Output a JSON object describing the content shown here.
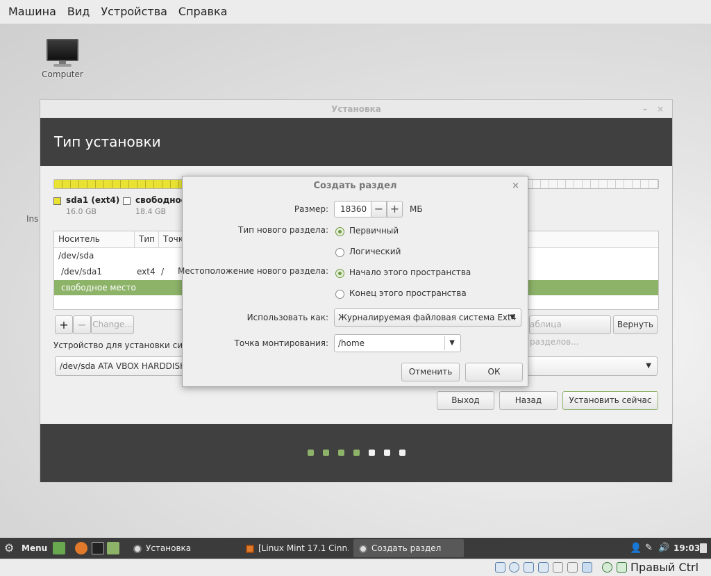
{
  "vbox_menu": [
    "Машина",
    "Вид",
    "Устройства",
    "Справка"
  ],
  "desktop": {
    "icon_label": "Computer",
    "partial_text": "Ins"
  },
  "installer": {
    "title": "Установка",
    "minimize": "–",
    "close": "×",
    "header": "Тип установки",
    "legend": [
      {
        "name": "sda1 (ext4)",
        "size": "16.0 GB",
        "color": "#e9e233"
      },
      {
        "name": "свободное",
        "size": "18.4 GB",
        "color": "#ffffff"
      }
    ],
    "table": {
      "headers": [
        "Носитель",
        "Тип",
        "Точк"
      ],
      "rows": [
        {
          "device": "/dev/sda",
          "type": "",
          "mount": ""
        },
        {
          "device": "/dev/sda1",
          "type": "ext4",
          "mount": "/"
        },
        {
          "device": "свободное место",
          "type": "",
          "mount": ""
        }
      ]
    },
    "buttons": {
      "add": "+",
      "remove": "−",
      "change": "Change...",
      "new_table": "аблица разделов...",
      "revert": "Вернуть",
      "quit": "Выход",
      "back": "Назад",
      "install": "Установить сейчас"
    },
    "device_label": "Устройство для установки сист",
    "device_value": "/dev/sda   ATA VBOX HARDDISK",
    "progress_dots": [
      true,
      true,
      true,
      true,
      false,
      false,
      false
    ]
  },
  "dialog": {
    "title": "Создать раздел",
    "close": "×",
    "size_label": "Размер:",
    "size_value": "18360",
    "minus": "−",
    "plus": "+",
    "size_unit": "МБ",
    "type_label": "Тип нового раздела:",
    "type_primary": "Первичный",
    "type_logical": "Логический",
    "location_label": "Местоположение нового раздела:",
    "location_begin": "Начало этого пространства",
    "location_end": "Конец этого пространства",
    "use_as_label": "Использовать как:",
    "use_as_value": "Журналируемая файловая система Ext4",
    "mount_label": "Точка монтирования:",
    "mount_value": "/home",
    "cancel": "Отменить",
    "ok": "ОК"
  },
  "taskbar": {
    "menu": "Menu",
    "tasks": [
      "Установка",
      "[Linux Mint 17.1 Cinn...",
      "Создать раздел"
    ],
    "time": "19:03"
  },
  "statusbar": {
    "host_key": "Правый Ctrl"
  }
}
